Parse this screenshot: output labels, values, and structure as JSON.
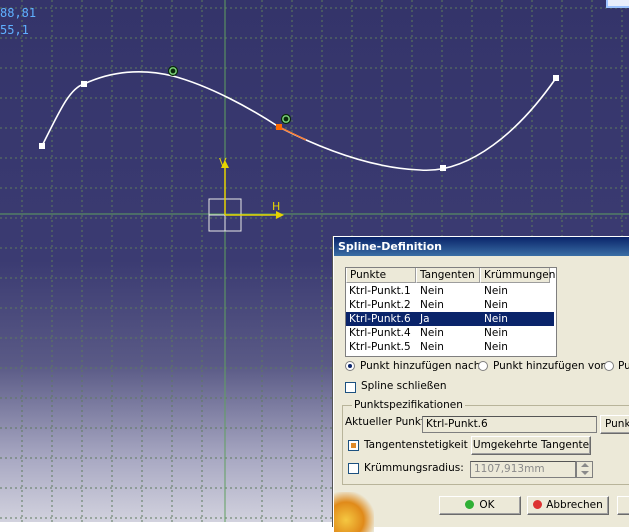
{
  "viewport": {
    "coord_readout": [
      "88,81",
      "55,1"
    ],
    "axis_labels": {
      "v": "V",
      "h": "H"
    },
    "colors": {
      "background": "#34346a",
      "grid": "#5a6d5a",
      "spline": "#ffffff",
      "axis": "#e0d000",
      "accent": "#ff6a00"
    }
  },
  "dialog": {
    "title": "Spline-Definition",
    "columns": [
      "Punkte",
      "Tangenten",
      "Krümmungen"
    ],
    "rows": [
      {
        "punkt": "Ktrl-Punkt.1",
        "tangente": "Nein",
        "kruemmung": "Nein"
      },
      {
        "punkt": "Ktrl-Punkt.2",
        "tangente": "Nein",
        "kruemmung": "Nein"
      },
      {
        "punkt": "Ktrl-Punkt.6",
        "tangente": "Ja",
        "kruemmung": "Nein"
      },
      {
        "punkt": "Ktrl-Punkt.4",
        "tangente": "Nein",
        "kruemmung": "Nein"
      },
      {
        "punkt": "Ktrl-Punkt.5",
        "tangente": "Nein",
        "kruemmung": "Nein"
      }
    ],
    "selected_row": 2,
    "radio_add_after": "Punkt hinzufügen nach",
    "radio_add_before": "Punkt hinzufügen vor",
    "radio_third": "Pu",
    "close_spline": "Spline schließen",
    "group_title": "Punktspezifikationen",
    "current_point_label": "Aktueller Punkt:",
    "current_point_value": "Ktrl-Punkt.6",
    "point_button": "Punkt",
    "tangent_label": "Tangentenstetigkeit",
    "reverse_tangent": "Umgekehrte Tangente",
    "curvature_label": "Krümmungsradius:",
    "curvature_value": "1107,913mm",
    "ok": "OK",
    "cancel": "Abbrechen"
  }
}
